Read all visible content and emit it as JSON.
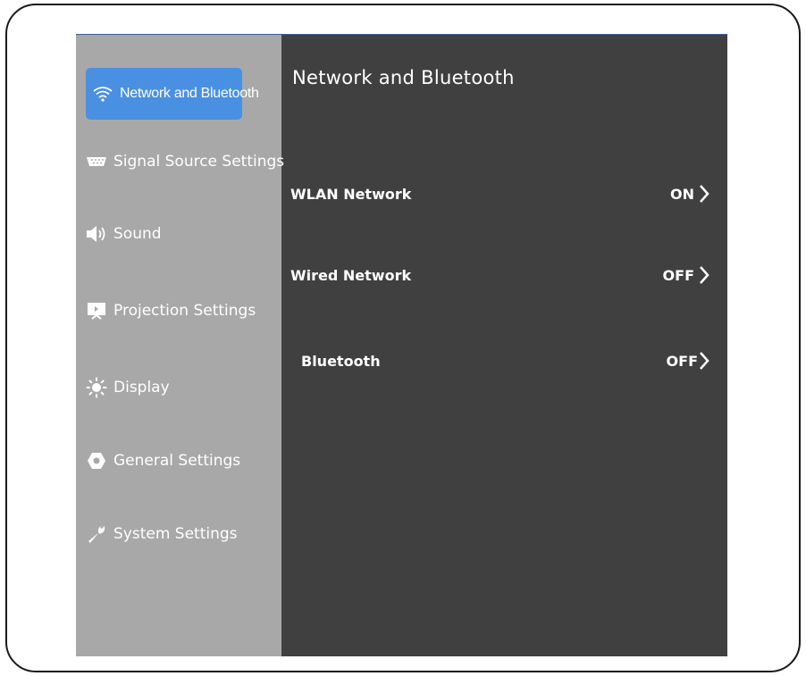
{
  "sidebar": {
    "items": [
      {
        "label": "Network and Bluetooth",
        "icon": "wifi-icon",
        "active": true
      },
      {
        "label": "Signal Source Settings",
        "icon": "input-source-icon"
      },
      {
        "label": "Sound",
        "icon": "speaker-icon"
      },
      {
        "label": "Projection Settings",
        "icon": "projection-icon"
      },
      {
        "label": "Display",
        "icon": "brightness-icon"
      },
      {
        "label": "General Settings",
        "icon": "hexagon-gear-icon"
      },
      {
        "label": "System Settings",
        "icon": "wrench-icon"
      }
    ]
  },
  "main": {
    "title": "Network and Bluetooth",
    "settings": [
      {
        "label": "WLAN Network",
        "value": "ON"
      },
      {
        "label": "Wired Network",
        "value": "OFF"
      },
      {
        "label": "Bluetooth",
        "value": "OFF"
      }
    ]
  },
  "colors": {
    "accent": "#4a90e2",
    "sidebar_bg": "#a8a8a8",
    "panel_bg": "#404040"
  }
}
